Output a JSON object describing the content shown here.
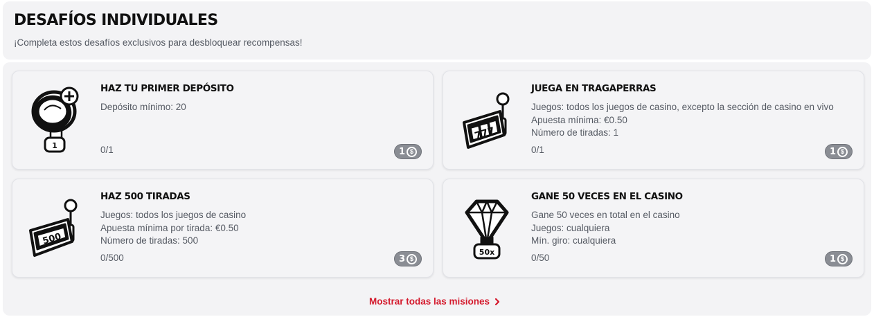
{
  "header": {
    "title": "DESAFÍOS INDIVIDUALES",
    "subtitle": "¡Completa estos desafíos exclusivos para desbloquear recompensas!"
  },
  "challenges": [
    {
      "icon": "coin-plus-icon",
      "icon_badge": "1",
      "title": "HAZ TU PRIMER DEPÓSITO",
      "details": [
        "Depósito mínimo: 20"
      ],
      "progress": "0/1",
      "reward": "1"
    },
    {
      "icon": "slot-machine-icon",
      "icon_badge": "777",
      "title": "JUEGA EN TRAGAPERRAS",
      "details": [
        "Juegos: todos los juegos de casino, excepto la sección de casino en vivo",
        "Apuesta mínima: €0.50",
        "Número de tiradas: 1"
      ],
      "progress": "0/1",
      "reward": "1"
    },
    {
      "icon": "slot-machine-icon",
      "icon_badge": "500",
      "title": "HAZ 500 TIRADAS",
      "details": [
        "Juegos: todos los juegos de casino",
        "Apuesta mínima por tirada: €0.50",
        "Número de tiradas: 500"
      ],
      "progress": "0/500",
      "reward": "3"
    },
    {
      "icon": "diamond-icon",
      "icon_badge": "50x",
      "title": "GANE 50 VECES EN EL CASINO",
      "details": [
        "Gane 50 veces en total en el casino",
        "Juegos: cualquiera",
        "Mín. giro: cualquiera"
      ],
      "progress": "0/50",
      "reward": "1"
    }
  ],
  "reward_icon": "coin-icon",
  "coin_symbol": "$",
  "footer": {
    "show_all_label": "Mostrar todas las misiones",
    "icon": "chevron-right-icon"
  },
  "colors": {
    "link": "#d4192c",
    "badge": "#8a8d94",
    "panel": "#f3f3f5"
  }
}
